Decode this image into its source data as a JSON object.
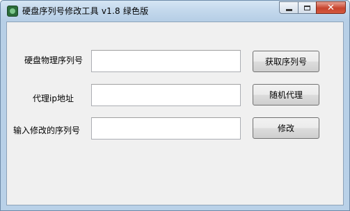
{
  "window": {
    "title": "硬盘序列号修改工具 v1.8 绿色版",
    "icon": "app-icon",
    "controls": {
      "minimize": "minimize-icon",
      "maximize": "maximize-icon",
      "close": "close-icon",
      "close_glyph": "✕"
    }
  },
  "form": {
    "rows": [
      {
        "label": "硬盘物理序列号",
        "value": "",
        "button": "获取序列号"
      },
      {
        "label": "代理ip地址",
        "value": "",
        "button": "随机代理"
      },
      {
        "label": "输入修改的序列号",
        "value": "",
        "button": "修改"
      }
    ]
  }
}
